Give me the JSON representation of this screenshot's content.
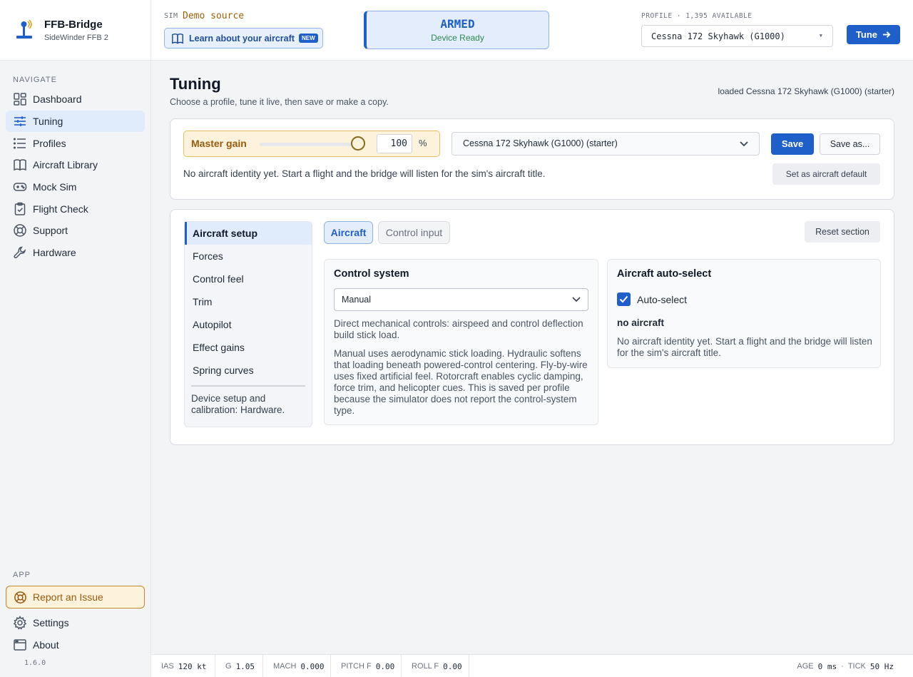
{
  "brand": {
    "title": "FFB-Bridge",
    "subtitle": "SideWinder FFB 2"
  },
  "sidebar": {
    "nav_heading": "NAVIGATE",
    "items": [
      {
        "label": "Dashboard",
        "icon": "dashboard-icon",
        "active": false
      },
      {
        "label": "Tuning",
        "icon": "sliders-icon",
        "active": true
      },
      {
        "label": "Profiles",
        "icon": "list-icon",
        "active": false
      },
      {
        "label": "Aircraft Library",
        "icon": "book-icon",
        "active": false
      },
      {
        "label": "Mock Sim",
        "icon": "gamepad-icon",
        "active": false
      },
      {
        "label": "Flight Check",
        "icon": "clipboard-check-icon",
        "active": false
      },
      {
        "label": "Support",
        "icon": "lifebuoy-icon",
        "active": false
      },
      {
        "label": "Hardware",
        "icon": "wrench-icon",
        "active": false
      }
    ],
    "app_heading": "APP",
    "report": "Report an Issue",
    "settings": "Settings",
    "about": "About",
    "version": "1.6.0"
  },
  "topbar": {
    "sim_label": "SIM",
    "sim_value": "Demo source",
    "learn_label": "Learn about your aircraft",
    "new_badge": "NEW",
    "status_title": "ARMED",
    "status_sub": "Device Ready",
    "profile_label": "PROFILE · 1,395 AVAILABLE",
    "profile_value": "Cessna 172 Skyhawk (G1000)",
    "tune_label": "Tune"
  },
  "page": {
    "title": "Tuning",
    "subtitle": "Choose a profile, tune it live, then save or make a copy.",
    "loaded": "loaded Cessna 172 Skyhawk (G1000) (starter)"
  },
  "master": {
    "label": "Master gain",
    "value": "100",
    "unit": "%",
    "level": 1.0,
    "profile_select": "Cessna 172 Skyhawk (G1000) (starter)",
    "save": "Save",
    "save_as": "Save as...",
    "identity_msg": "No aircraft identity yet. Start a flight and the bridge will listen for the sim's aircraft title.",
    "set_default": "Set as aircraft default"
  },
  "sections": {
    "items": [
      "Aircraft setup",
      "Forces",
      "Control feel",
      "Trim",
      "Autopilot",
      "Effect gains",
      "Spring curves"
    ],
    "note": "Device setup and calibration: Hardware."
  },
  "tabs": {
    "aircraft": "Aircraft",
    "control_input": "Control input",
    "reset": "Reset section"
  },
  "control_system": {
    "title": "Control system",
    "select_value": "Manual",
    "desc": "Direct mechanical controls: airspeed and control deflection build stick load.",
    "long": "Manual uses aerodynamic stick loading. Hydraulic softens that loading beneath powered-control centering. Fly-by-wire uses fixed artificial feel. Rotorcraft enables cyclic damping, force trim, and helicopter cues. This is saved per profile because the simulator does not report the control-system type."
  },
  "auto_select": {
    "title": "Aircraft auto-select",
    "checkbox_label": "Auto-select",
    "checked": true,
    "status": "no aircraft",
    "desc": "No aircraft identity yet. Start a flight and the bridge will listen for the sim's aircraft title."
  },
  "statusbar": {
    "ias_label": "IAS",
    "ias_value": "120 kt",
    "g_label": "G",
    "g_value": "1.05",
    "mach_label": "MACH",
    "mach_value": "0.000",
    "pitch_label": "PITCH F",
    "pitch_value": "0.00",
    "roll_label": "ROLL F",
    "roll_value": "0.00",
    "age_label": "AGE",
    "age_value": "0 ms",
    "sep": "·",
    "tick_label": "TICK",
    "tick_value": "50 Hz"
  },
  "colors": {
    "accent": "#1f5fc9",
    "warning": "#c2872b",
    "success": "#2b8a4f"
  }
}
